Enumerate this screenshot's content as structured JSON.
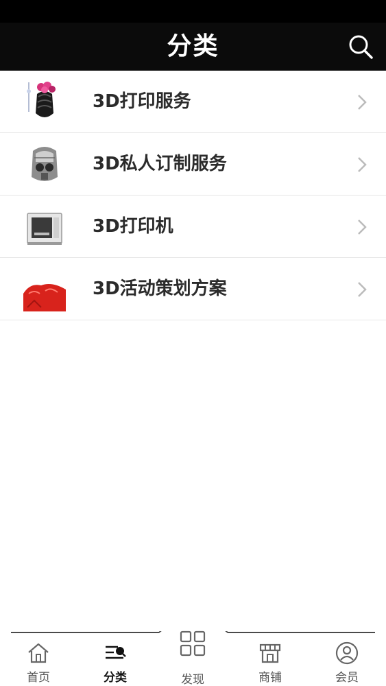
{
  "header": {
    "title": "分类",
    "search_icon": "search-icon"
  },
  "categories": [
    {
      "label": "3D打印服务",
      "thumb": "vase-thumbnail"
    },
    {
      "label": "3D私人订制服务",
      "thumb": "helmet-thumbnail"
    },
    {
      "label": "3D打印机",
      "thumb": "printer-thumbnail"
    },
    {
      "label": "3D活动策划方案",
      "thumb": "red-model-thumbnail"
    }
  ],
  "tabbar": {
    "tabs": [
      {
        "label": "首页",
        "icon": "home-icon"
      },
      {
        "label": "分类",
        "icon": "category-icon",
        "active": true
      },
      {
        "label": "发现",
        "icon": "grid-icon"
      },
      {
        "label": "商铺",
        "icon": "store-icon"
      },
      {
        "label": "会员",
        "icon": "user-icon"
      }
    ]
  },
  "colors": {
    "header_bg": "#0b0b0b",
    "text": "#2b2b2b",
    "divider": "#e6e6e6",
    "chevron": "#bbbbbb"
  }
}
